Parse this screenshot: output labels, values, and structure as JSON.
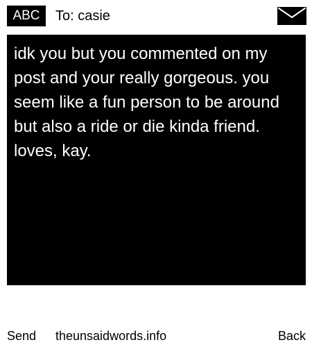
{
  "header": {
    "input_mode": "ABC",
    "to_label": "To: casie",
    "envelope_icon": "envelope-icon"
  },
  "message": {
    "text": "idk you but you commented on my post and your really gorgeous. you seem like a fun person to be around but also a ride or die kinda friend. loves, kay."
  },
  "footer": {
    "send_label": "Send",
    "site_text": "theunsaidwords.info",
    "back_label": "Back"
  },
  "colors": {
    "background": "#ffffff",
    "message_background": "#000000",
    "message_text": "#ffffff"
  }
}
